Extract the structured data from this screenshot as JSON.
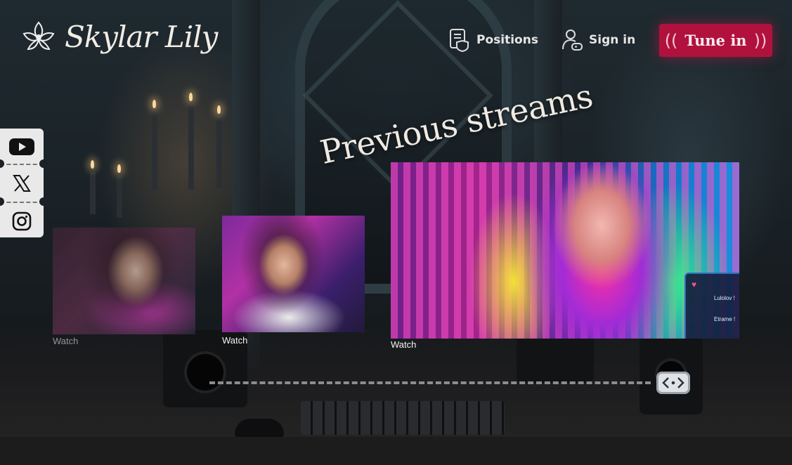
{
  "brand": {
    "name": "Skylar Lily"
  },
  "nav": {
    "positions_label": "Positions",
    "signin_label": "Sign in",
    "tune_in": {
      "label": "Tune in",
      "paren_left": "((",
      "paren_right": "))"
    }
  },
  "social": [
    {
      "network": "YouTube",
      "icon": "youtube-icon"
    },
    {
      "network": "X",
      "icon": "x-icon"
    },
    {
      "network": "Instagram",
      "icon": "instagram-icon"
    }
  ],
  "section": {
    "title": "Previous streams"
  },
  "streams": [
    {
      "watch_label": "Watch",
      "state": "dimmed"
    },
    {
      "watch_label": "Watch",
      "state": "normal"
    },
    {
      "watch_label": "Watch",
      "state": "featured",
      "overlay": {
        "line1": "Lulolov !",
        "line2": "Etrame !"
      }
    }
  ],
  "slider": {
    "handle_icon": "code-brackets-icon"
  },
  "colors": {
    "accent": "#b0123d",
    "text": "#efeae2",
    "rail": "#e9e9e9"
  }
}
